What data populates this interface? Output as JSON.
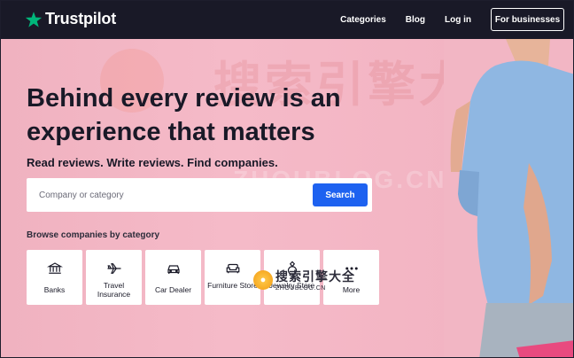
{
  "nav": {
    "brand": "Trustpilot",
    "links": [
      "Categories",
      "Blog",
      "Log in"
    ],
    "business_button": "For businesses",
    "colors": {
      "background": "#191927",
      "star": "#00b67a"
    }
  },
  "hero": {
    "headline": "Behind every review is an experience that matters",
    "subheadline": "Read reviews. Write reviews. Find companies.",
    "search": {
      "placeholder": "Company or category",
      "button_label": "Search",
      "button_color": "#1e62f0"
    },
    "browse_label": "Browse companies by category",
    "categories": [
      {
        "label": "Banks",
        "icon": "bank-icon"
      },
      {
        "label": "Travel Insurance",
        "icon": "airplane-icon"
      },
      {
        "label": "Car Dealer",
        "icon": "car-icon"
      },
      {
        "label": "Furniture Store",
        "icon": "sofa-icon"
      },
      {
        "label": "Jewelry Store",
        "icon": "ring-icon"
      },
      {
        "label": "More",
        "icon": "more-dots-icon"
      }
    ],
    "background_color": "#f3b5c3"
  },
  "watermark": {
    "big_text": "搜索引擎大全",
    "url_text": "ZHOUBLOG.CN",
    "small_title": "搜索引擎大全",
    "small_url": "ZHOUBLOG.CN"
  }
}
